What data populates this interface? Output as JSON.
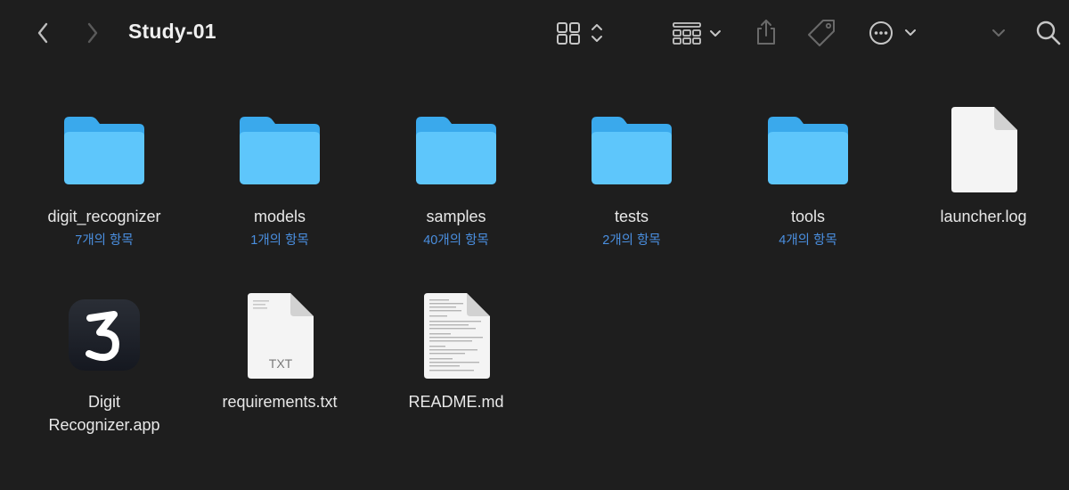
{
  "window": {
    "title": "Study-01"
  },
  "toolbar": {
    "back": "chevron-left-icon",
    "forward": "chevron-right-icon",
    "view_mode": "grid-view-icon",
    "group_by": "group-icon",
    "share": "share-icon",
    "tags": "tag-icon",
    "more": "more-icon",
    "search": "search-icon"
  },
  "items": [
    {
      "name": "digit_recognizer",
      "kind": "folder",
      "count": "7개의 항목"
    },
    {
      "name": "models",
      "kind": "folder",
      "count": "1개의 항목"
    },
    {
      "name": "samples",
      "kind": "folder",
      "count": "40개의 항목"
    },
    {
      "name": "tests",
      "kind": "folder",
      "count": "2개의 항목"
    },
    {
      "name": "tools",
      "kind": "folder",
      "count": "4개의 항목"
    },
    {
      "name": "launcher.log",
      "kind": "file"
    },
    {
      "name_line1": "Digit",
      "name_line2": "Recognizer.app",
      "kind": "app",
      "app_glyph": "3"
    },
    {
      "name": "requirements.txt",
      "kind": "txt",
      "file_label": "TXT"
    },
    {
      "name": "README.md",
      "kind": "md"
    }
  ],
  "colors": {
    "background": "#1e1e1e",
    "folder": "#5ac8fa",
    "count_text": "#4a8fe0"
  }
}
